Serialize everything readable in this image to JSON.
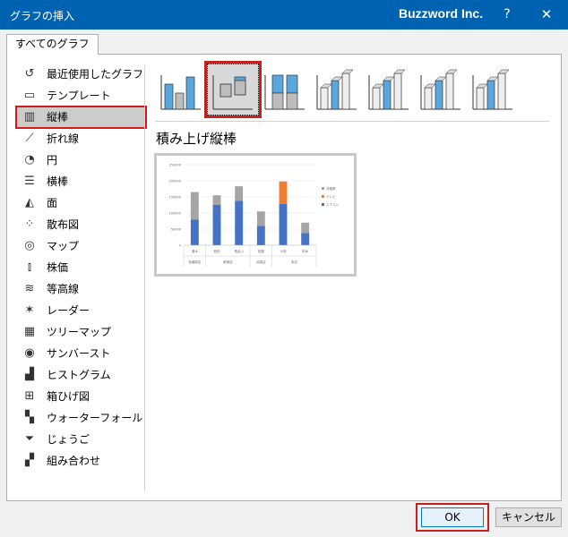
{
  "titlebar": {
    "title": "グラフの挿入",
    "brand": "Buzzword Inc.",
    "help": "?",
    "close": "✕"
  },
  "tab": {
    "label": "すべてのグラフ"
  },
  "sidebar": {
    "items": [
      {
        "label": "最近使用したグラフ",
        "icon": "recent-icon"
      },
      {
        "label": "テンプレート",
        "icon": "folder-icon"
      },
      {
        "label": "縦棒",
        "icon": "column-chart-icon",
        "selected": true
      },
      {
        "label": "折れ線",
        "icon": "line-chart-icon"
      },
      {
        "label": "円",
        "icon": "pie-chart-icon"
      },
      {
        "label": "横棒",
        "icon": "bar-chart-icon"
      },
      {
        "label": "面",
        "icon": "area-chart-icon"
      },
      {
        "label": "散布図",
        "icon": "scatter-chart-icon"
      },
      {
        "label": "マップ",
        "icon": "map-chart-icon"
      },
      {
        "label": "株価",
        "icon": "stock-chart-icon"
      },
      {
        "label": "等高線",
        "icon": "surface-chart-icon"
      },
      {
        "label": "レーダー",
        "icon": "radar-chart-icon"
      },
      {
        "label": "ツリーマップ",
        "icon": "treemap-icon"
      },
      {
        "label": "サンバースト",
        "icon": "sunburst-icon"
      },
      {
        "label": "ヒストグラム",
        "icon": "histogram-icon"
      },
      {
        "label": "箱ひげ図",
        "icon": "box-whisker-icon"
      },
      {
        "label": "ウォーターフォール",
        "icon": "waterfall-icon"
      },
      {
        "label": "じょうご",
        "icon": "funnel-icon"
      },
      {
        "label": "組み合わせ",
        "icon": "combo-chart-icon"
      }
    ]
  },
  "subtypes": [
    {
      "name": "clustered-column-icon"
    },
    {
      "name": "stacked-column-icon",
      "selected": true
    },
    {
      "name": "100-stacked-column-icon"
    },
    {
      "name": "3d-clustered-column-icon"
    },
    {
      "name": "3d-stacked-column-icon"
    },
    {
      "name": "3d-100-stacked-column-icon"
    },
    {
      "name": "3d-column-icon"
    }
  ],
  "subtitle": "積み上げ縦棒",
  "chart_data": {
    "type": "bar",
    "stacked": true,
    "categories": [
      "清水",
      "西田",
      "長谷川",
      "佐藤",
      "小島",
      "鈴木"
    ],
    "groups": [
      "秋葉原店",
      "新宿店",
      "池袋店",
      "本店"
    ],
    "group_spans": [
      1,
      2,
      1,
      2
    ],
    "series": [
      {
        "name": "エアコン",
        "color": "#4472c4",
        "values": [
          80000,
          125000,
          138000,
          60000,
          128000,
          38000
        ]
      },
      {
        "name": "テレビ",
        "color": "#ed7d31",
        "values": [
          0,
          0,
          0,
          0,
          70000,
          0
        ]
      },
      {
        "name": "冷蔵庫",
        "color": "#a5a5a5",
        "values": [
          85000,
          30000,
          45000,
          45000,
          0,
          32000
        ]
      }
    ],
    "ylim": [
      0,
      250000
    ],
    "yticks": [
      "0",
      "50000",
      "100000",
      "150000",
      "200000",
      "250000"
    ],
    "legend_position": "right"
  },
  "buttons": {
    "ok": "OK",
    "cancel": "キャンセル"
  }
}
